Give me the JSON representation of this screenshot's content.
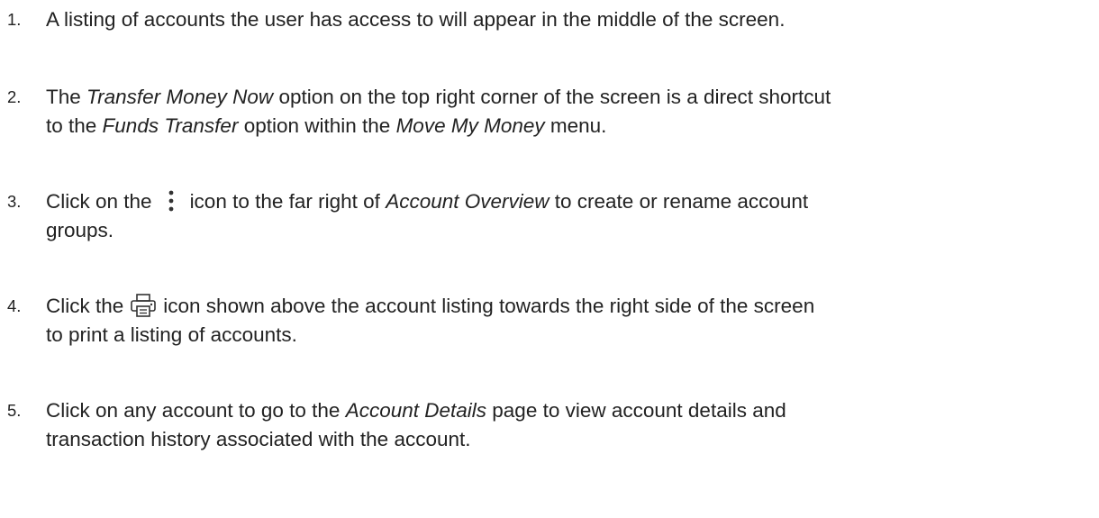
{
  "steps": [
    {
      "number": "1.",
      "text": "A listing of accounts the user has access to will appear in the middle of the screen."
    },
    {
      "number": "2.",
      "part1": "The ",
      "em1": "Transfer Money Now",
      "part2": " option on the top right corner of the screen is a direct shortcut",
      "part3": "to the ",
      "em2": "Funds Transfer",
      "part4": " option within the ",
      "em3": "Move My Money",
      "part5": " menu."
    },
    {
      "number": "3.",
      "part1": "Click on the",
      "icon": "more-vertical-icon",
      "part2": "icon to the far right of ",
      "em1": "Account Overview",
      "part3": " to create or rename account",
      "part4": "groups."
    },
    {
      "number": "4.",
      "part1": "Click the",
      "icon": "print-icon",
      "part2": "icon shown above the account listing towards the right side of the screen",
      "part3": "to print a listing of accounts."
    },
    {
      "number": "5.",
      "part1": "Click on any account to go to the ",
      "em1": "Account Details",
      "part2": " page to view account details and",
      "part3": "transaction history associated with the account."
    }
  ],
  "colors": {
    "text": "#222222",
    "icon": "#333333",
    "background": "#ffffff"
  }
}
